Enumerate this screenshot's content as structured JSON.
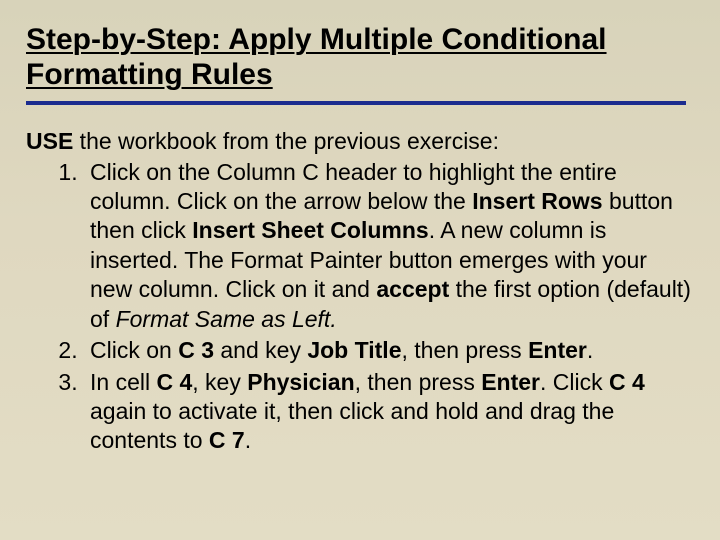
{
  "title": "Step-by-Step: Apply Multiple Conditional Formatting Rules",
  "intro_lead": "USE",
  "intro_rest": " the workbook from the previous exercise:",
  "steps": {
    "s1": {
      "t1": "Click on the Column C header to highlight the entire column. Click on the arrow below the ",
      "b1": "Insert Rows",
      "t2": " button then click ",
      "b2": "Insert Sheet Columns",
      "t3": ". A new column is inserted. The Format Painter button emerges with your new column. Click on it and ",
      "b3": "accept",
      "t4": " the first option (default) of ",
      "i1": "Format Same as Left.",
      "t5": ""
    },
    "s2": {
      "t1": "Click on ",
      "b1": "C 3",
      "t2": " and key ",
      "b2": "Job Title",
      "t3": ", then press ",
      "b3": "Enter",
      "t4": "."
    },
    "s3": {
      "t1": "In cell ",
      "b1": "C 4",
      "t2": ", key ",
      "b2": "Physician",
      "t3": ", then press ",
      "b3": "Enter",
      "t4": ". Click ",
      "b4": "C 4",
      "t5": " again to activate it, then click and hold and drag the contents to ",
      "b5": "C 7",
      "t6": "."
    }
  }
}
